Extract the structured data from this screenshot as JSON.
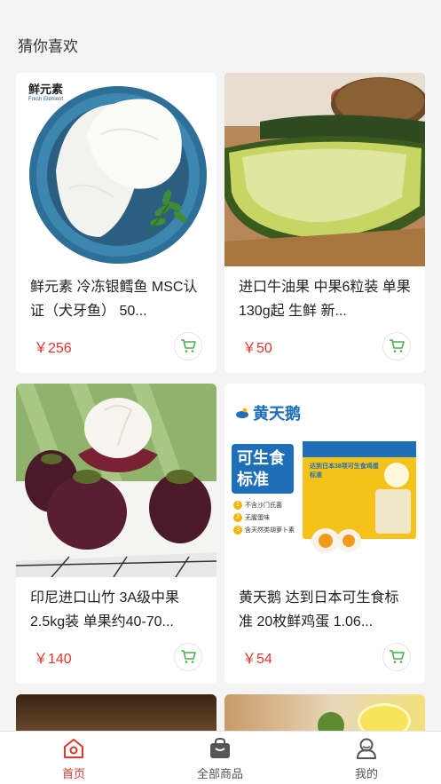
{
  "section": {
    "title": "猜你喜欢"
  },
  "products": [
    {
      "brand": "鲜元素",
      "brand_sub": "Fresh Element",
      "title": "鲜元素 冷冻银鳕鱼 MSC认证（犬牙鱼） 50...",
      "price": "￥256"
    },
    {
      "title": "进口牛油果 中果6粒装 单果130g起 生鲜 新...",
      "price": "￥50"
    },
    {
      "title": "印尼进口山竹 3A级中果 2.5kg装 单果约40-70...",
      "price": "￥140"
    },
    {
      "brand": "黄天鹅",
      "box_text": "可生食标准",
      "box_list": [
        "不含沙门氏菌",
        "无腥蛋味",
        "含天然类胡萝卜素"
      ],
      "box_banner": "达到日本38项可生食鸡蛋标准",
      "title": "黄天鹅 达到日本可生食标准 20枚鲜鸡蛋 1.06...",
      "price": "￥54"
    }
  ],
  "tabbar": {
    "items": [
      {
        "label": "首页",
        "icon": "home-icon",
        "active": true
      },
      {
        "label": "全部商品",
        "icon": "bag-icon",
        "active": false
      },
      {
        "label": "我的",
        "icon": "user-icon",
        "active": false
      }
    ]
  },
  "colors": {
    "accent": "#e0362c",
    "cart": "#4caf50"
  }
}
